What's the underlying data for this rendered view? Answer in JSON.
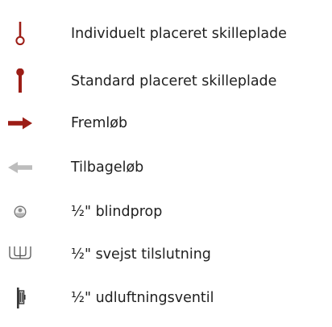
{
  "legend": {
    "items": [
      {
        "icon": "individual-divider-plate-icon",
        "label": "Individuelt placeret skilleplade"
      },
      {
        "icon": "standard-divider-plate-icon",
        "label": "Standard placeret skilleplade"
      },
      {
        "icon": "flow-arrow-icon",
        "label": "Fremløb"
      },
      {
        "icon": "return-arrow-icon",
        "label": "Tilbageløb"
      },
      {
        "icon": "blind-plug-icon",
        "label": "½\" blindprop"
      },
      {
        "icon": "weld-connection-icon",
        "label": "½\" svejst tilslutning"
      },
      {
        "icon": "air-vent-valve-icon",
        "label": "½\" udluftningsventil"
      }
    ],
    "colors": {
      "accent_red": "#9c1d16",
      "arrow_grey": "#bdbdbd",
      "icon_dark": "#555555",
      "text": "#1f1f1f"
    }
  }
}
